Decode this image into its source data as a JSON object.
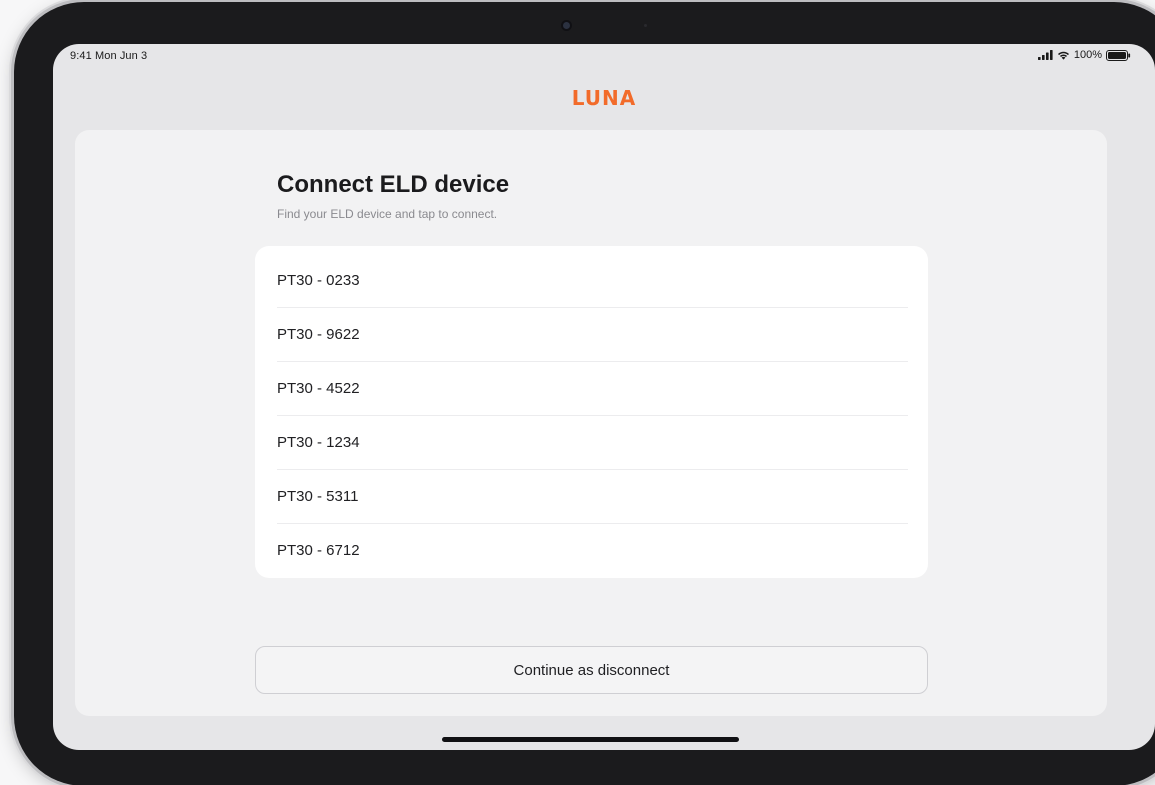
{
  "status_bar": {
    "time": "9:41 Mon Jun 3",
    "battery": "100%"
  },
  "brand": {
    "logo": "LUNA",
    "color": "#f26b2a"
  },
  "connect": {
    "title": "Connect ELD device",
    "subtitle": "Find your ELD device and tap to connect.",
    "devices": [
      {
        "label": "PT30 - 0233"
      },
      {
        "label": "PT30 - 9622"
      },
      {
        "label": "PT30 - 4522"
      },
      {
        "label": "PT30 - 1234"
      },
      {
        "label": "PT30 - 5311"
      },
      {
        "label": "PT30 - 6712"
      }
    ],
    "continue_label": "Continue as disconnect"
  },
  "icons": {
    "signal": "cellular-signal-icon",
    "wifi": "wifi-icon",
    "battery": "battery-icon"
  }
}
